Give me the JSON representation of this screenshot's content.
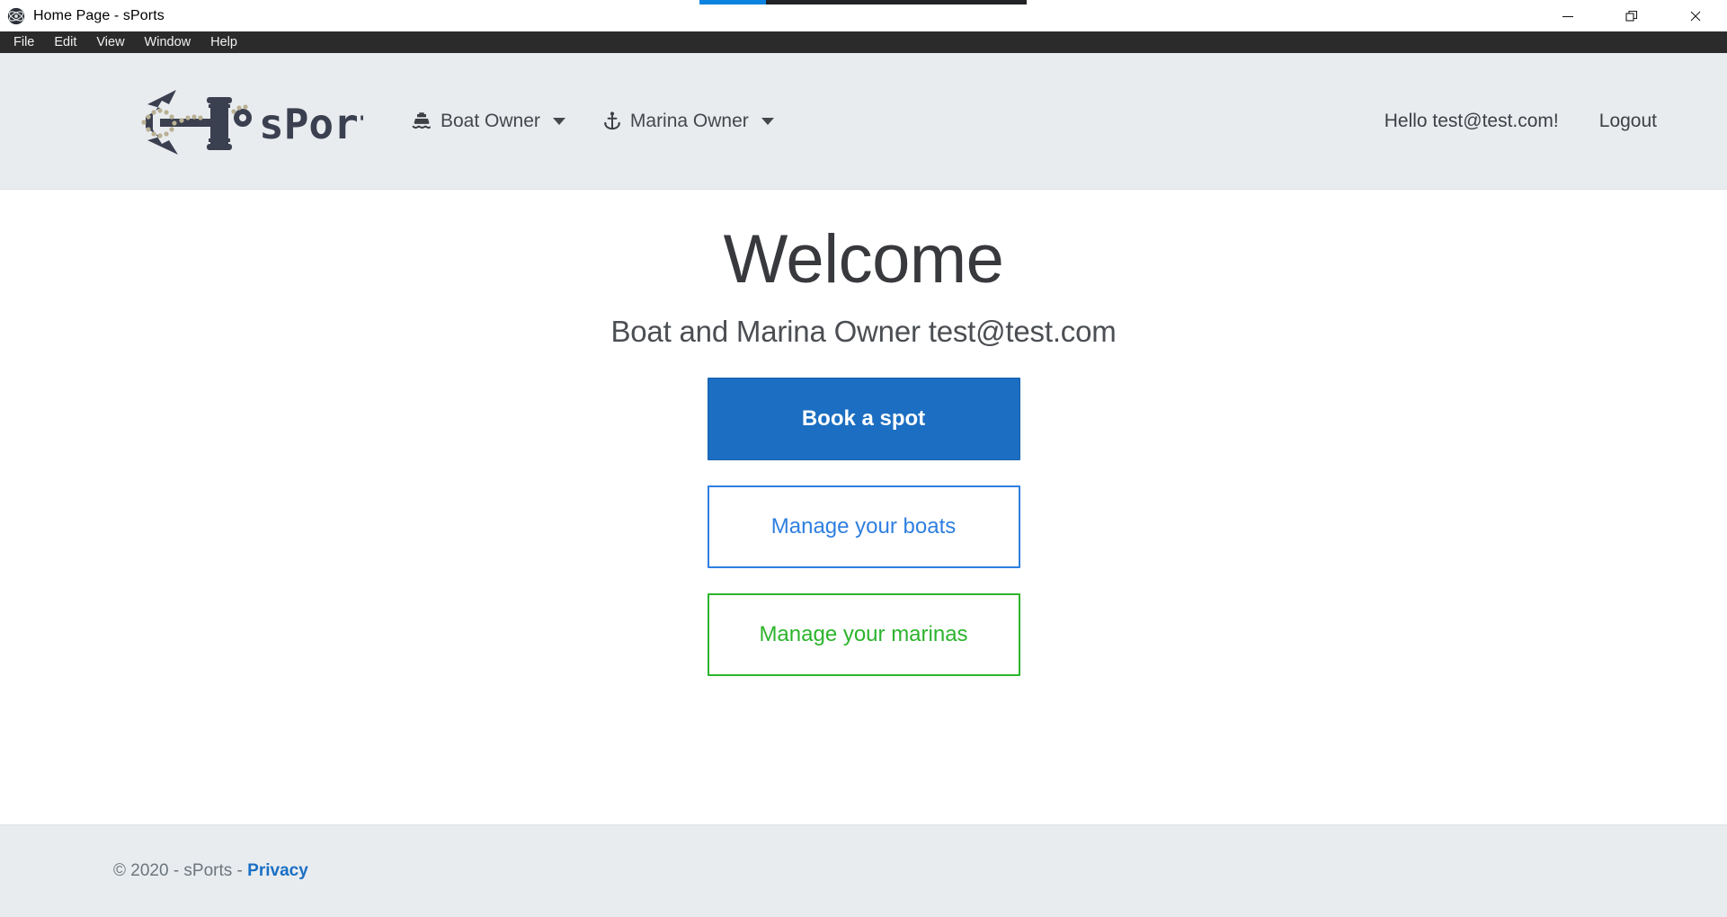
{
  "window": {
    "title": "Home Page - sPorts",
    "app_icon": "electron-atom-icon",
    "controls": {
      "minimize": "minimize-icon",
      "restore": "restore-icon",
      "close": "close-icon"
    },
    "progress_bar": {
      "loaded_color": "#0a84e0",
      "track_color": "#222326",
      "percent": 20
    }
  },
  "menubar": {
    "items": [
      {
        "label": "File"
      },
      {
        "label": "Edit"
      },
      {
        "label": "View"
      },
      {
        "label": "Window"
      },
      {
        "label": "Help"
      }
    ]
  },
  "header": {
    "brand": {
      "logo_icon": "anchor-logo-icon",
      "name": "sPorts"
    },
    "nav": [
      {
        "label": "Boat Owner",
        "icon": "ship-icon",
        "has_dropdown": true
      },
      {
        "label": "Marina Owner",
        "icon": "anchor-icon",
        "has_dropdown": true
      }
    ],
    "user": {
      "greeting": "Hello test@test.com!",
      "logout_label": "Logout"
    }
  },
  "main": {
    "title": "Welcome",
    "subtitle": "Boat and Marina Owner test@test.com",
    "buttons": [
      {
        "label": "Book a spot",
        "style": "primary",
        "color": "#1b6ec2"
      },
      {
        "label": "Manage your boats",
        "style": "outline-primary",
        "color": "#2f7fe0"
      },
      {
        "label": "Manage your marinas",
        "style": "outline-success",
        "color": "#2cb42c"
      }
    ]
  },
  "footer": {
    "copyright": "© 2020 - sPorts - ",
    "privacy_label": "Privacy"
  }
}
